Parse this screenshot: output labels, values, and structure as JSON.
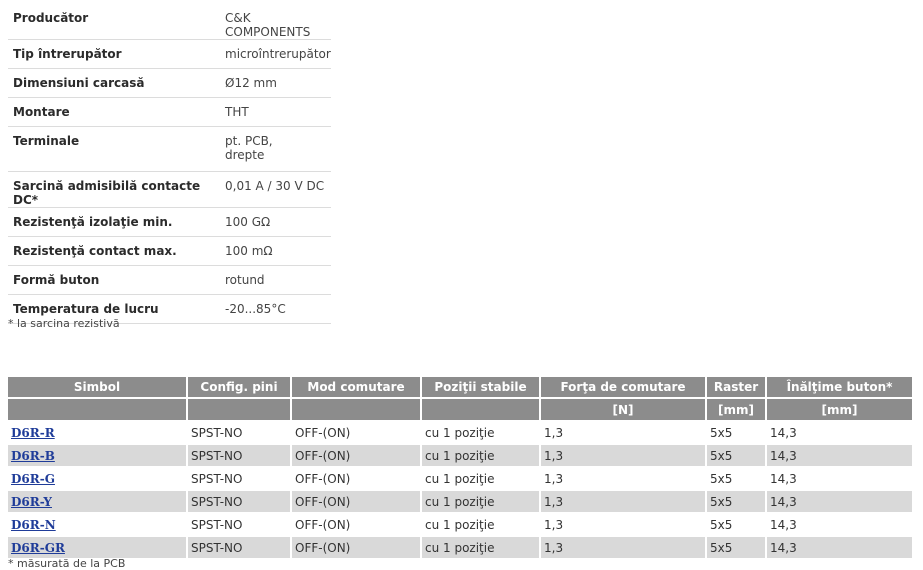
{
  "specs": [
    {
      "key": "Producător",
      "value": "C&K COMPONENTS"
    },
    {
      "key": "Tip întrerupător",
      "value": "microîntrerupător"
    },
    {
      "key": "Dimensiuni carcasă",
      "value": "Ø12 mm"
    },
    {
      "key": "Montare",
      "value": "THT"
    },
    {
      "key": "Terminale",
      "value_lines": [
        "pt. PCB,",
        "drepte"
      ]
    },
    {
      "key": "Sarcină admisibilă contacte DC*",
      "value": "0,01 A / 30 V DC"
    },
    {
      "key": "Rezistenţă izolaţie min.",
      "value": "100 GΩ"
    },
    {
      "key": "Rezistenţă contact max.",
      "value": "100 mΩ"
    },
    {
      "key": "Formă buton",
      "value": "rotund"
    },
    {
      "key": "Temperatura de lucru",
      "value": "-20...85°C"
    }
  ],
  "spec_note": "* la sarcina rezistivă",
  "products": {
    "headers": [
      "Simbol",
      "Config. pini",
      "Mod comutare",
      "Poziţii stabile",
      "Forţa de comutare",
      "Raster",
      "Înălţime buton*"
    ],
    "units": [
      "",
      "",
      "",
      "",
      "[N]",
      "[mm]",
      "[mm]"
    ],
    "rows": [
      [
        "D6R-R",
        "SPST-NO",
        "OFF-(ON)",
        "cu 1 poziţie",
        "1,3",
        "5x5",
        "14,3"
      ],
      [
        "D6R-B",
        "SPST-NO",
        "OFF-(ON)",
        "cu 1 poziţie",
        "1,3",
        "5x5",
        "14,3"
      ],
      [
        "D6R-G",
        "SPST-NO",
        "OFF-(ON)",
        "cu 1 poziţie",
        "1,3",
        "5x5",
        "14,3"
      ],
      [
        "D6R-Y",
        "SPST-NO",
        "OFF-(ON)",
        "cu 1 poziţie",
        "1,3",
        "5x5",
        "14,3"
      ],
      [
        "D6R-N",
        "SPST-NO",
        "OFF-(ON)",
        "cu 1 poziţie",
        "1,3",
        "5x5",
        "14,3"
      ],
      [
        "D6R-GR",
        "SPST-NO",
        "OFF-(ON)",
        "cu 1 poziţie",
        "1,3",
        "5x5",
        "14,3"
      ]
    ]
  },
  "products_note": "* măsurată de la PCB"
}
